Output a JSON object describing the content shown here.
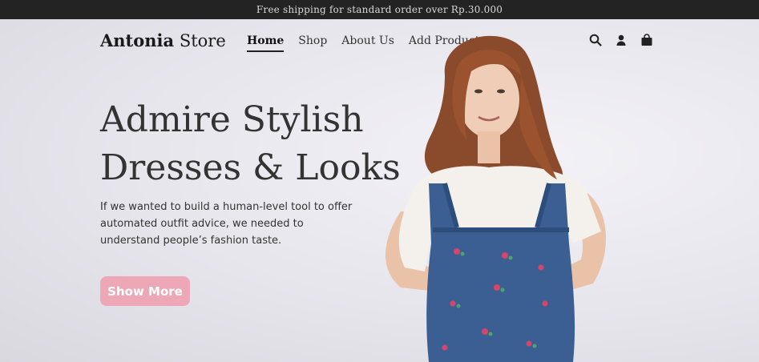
{
  "announcement": "Free shipping for standard order over Rp.30.000",
  "brand": {
    "name_bold": "Antonia",
    "name_rest": "Store"
  },
  "nav": [
    {
      "label": "Home",
      "active": true
    },
    {
      "label": "Shop",
      "active": false
    },
    {
      "label": "About Us",
      "active": false
    },
    {
      "label": "Add Product",
      "active": false
    }
  ],
  "header_icons": [
    "search-icon",
    "user-icon",
    "shopping-bag-icon"
  ],
  "hero": {
    "headline_line1": "Admire Stylish",
    "headline_line2": "Dresses & Looks",
    "description": "If we wanted to build a human-level tool to offer automated outfit advice, we needed to understand people’s fashion taste.",
    "cta_label": "Show More"
  },
  "colors": {
    "topbar": "#232323",
    "cta": "#eea7b6",
    "text": "#333333"
  }
}
